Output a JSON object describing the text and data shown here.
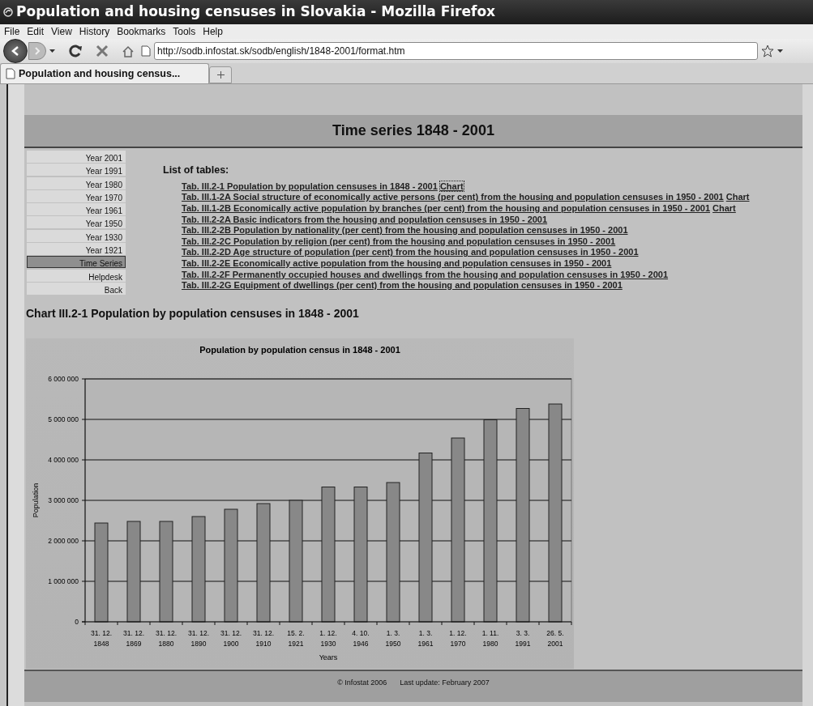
{
  "window": {
    "title": "Population and housing censuses in Slovakia - Mozilla Firefox"
  },
  "menu": [
    "File",
    "Edit",
    "View",
    "History",
    "Bookmarks",
    "Tools",
    "Help"
  ],
  "address_bar": {
    "value": "http://sodb.infostat.sk/sodb/english/1848-2001/format.htm"
  },
  "tabs": [
    {
      "label": "Population and housing census...",
      "selected": true
    }
  ],
  "page": {
    "title": "Time series 1848 - 2001",
    "sidebar": {
      "items": [
        {
          "label": "Year 2001",
          "selected": false
        },
        {
          "label": "Year 1991",
          "selected": false
        },
        {
          "label": "Year 1980",
          "selected": false
        },
        {
          "label": "Year 1970",
          "selected": false
        },
        {
          "label": "Year 1961",
          "selected": false
        },
        {
          "label": "Year 1950",
          "selected": false
        },
        {
          "label": "Year 1930",
          "selected": false
        },
        {
          "label": "Year 1921",
          "selected": false
        },
        {
          "label": "Time Series",
          "selected": true
        },
        {
          "label": "Helpdesk",
          "selected": false
        },
        {
          "label": "Back",
          "selected": false
        }
      ]
    },
    "list_title": "List of tables:",
    "tables": [
      {
        "text": "Tab. III.2-1 Population by population censuses in 1848 - 2001",
        "chart_link": {
          "label": "Chart",
          "focused": true
        }
      },
      {
        "text": "Tab. III.1-2A Social structure of economically active persons (per cent) from the housing and population censuses in 1950 - 2001",
        "chart_link": {
          "label": "Chart",
          "focused": false
        }
      },
      {
        "text": "Tab. III.1-2B Economically active population by branches (per cent) from the housing and population censuses in 1950 - 2001",
        "chart_link": {
          "label": "Chart",
          "focused": false
        }
      },
      {
        "text": "Tab. III.2-2A Basic indicators from the housing and population censuses in 1950 - 2001"
      },
      {
        "text": "Tab. III.2-2B Population by nationality (per cent) from the housing and population censuses in 1950 - 2001"
      },
      {
        "text": "Tab. III.2-2C Population by religion (per cent) from the housing and population censuses in 1950 - 2001"
      },
      {
        "text": "Tab. III.2-2D Age structure of population (per cent) from the housing and population censuses in 1950 - 2001"
      },
      {
        "text": "Tab. III.2-2E Economically active population from the housing and population censuses in 1950 - 2001"
      },
      {
        "text": "Tab. III.2-2F Permanently occupied houses and dwellings from the housing and population censuses in 1950 - 2001"
      },
      {
        "text": "Tab. III.2-2G Equipment of dwellings (per cent) from the housing and population censuses in 1950 - 2001"
      }
    ],
    "chart_heading": "Chart III.2-1 Population by population censuses in 1848 - 2001",
    "chart_data": {
      "type": "bar",
      "title": "Population by population census in 1848 - 2001",
      "xlabel": "Years",
      "ylabel": "Population",
      "categories": [
        "31. 12. 1848",
        "31. 12. 1869",
        "31. 12. 1880",
        "31. 12. 1890",
        "31. 12. 1900",
        "31. 12. 1910",
        "15. 2. 1921",
        "1. 12. 1930",
        "4. 10. 1946",
        "1. 3. 1950",
        "1. 3. 1961",
        "1. 12. 1970",
        "1. 11. 1980",
        "3. 3. 1991",
        "26. 5. 2001"
      ],
      "values": [
        2440000,
        2480000,
        2480000,
        2600000,
        2780000,
        2920000,
        3000000,
        3330000,
        3330000,
        3440000,
        4170000,
        4540000,
        4990000,
        5270000,
        5380000
      ],
      "grid": true,
      "ylim": [
        0,
        6000000
      ],
      "yticks": [
        {
          "value": 0,
          "label": "0"
        },
        {
          "value": 1000000,
          "label": "1 000 000"
        },
        {
          "value": 2000000,
          "label": "2 000 000"
        },
        {
          "value": 3000000,
          "label": "3 000 000"
        },
        {
          "value": 4000000,
          "label": "4 000 000"
        },
        {
          "value": 5000000,
          "label": "5 000 000"
        },
        {
          "value": 6000000,
          "label": "6 000 000"
        }
      ]
    },
    "footer": {
      "copyright": "© Infostat 2006",
      "updated": "Last update: February 2007"
    }
  }
}
